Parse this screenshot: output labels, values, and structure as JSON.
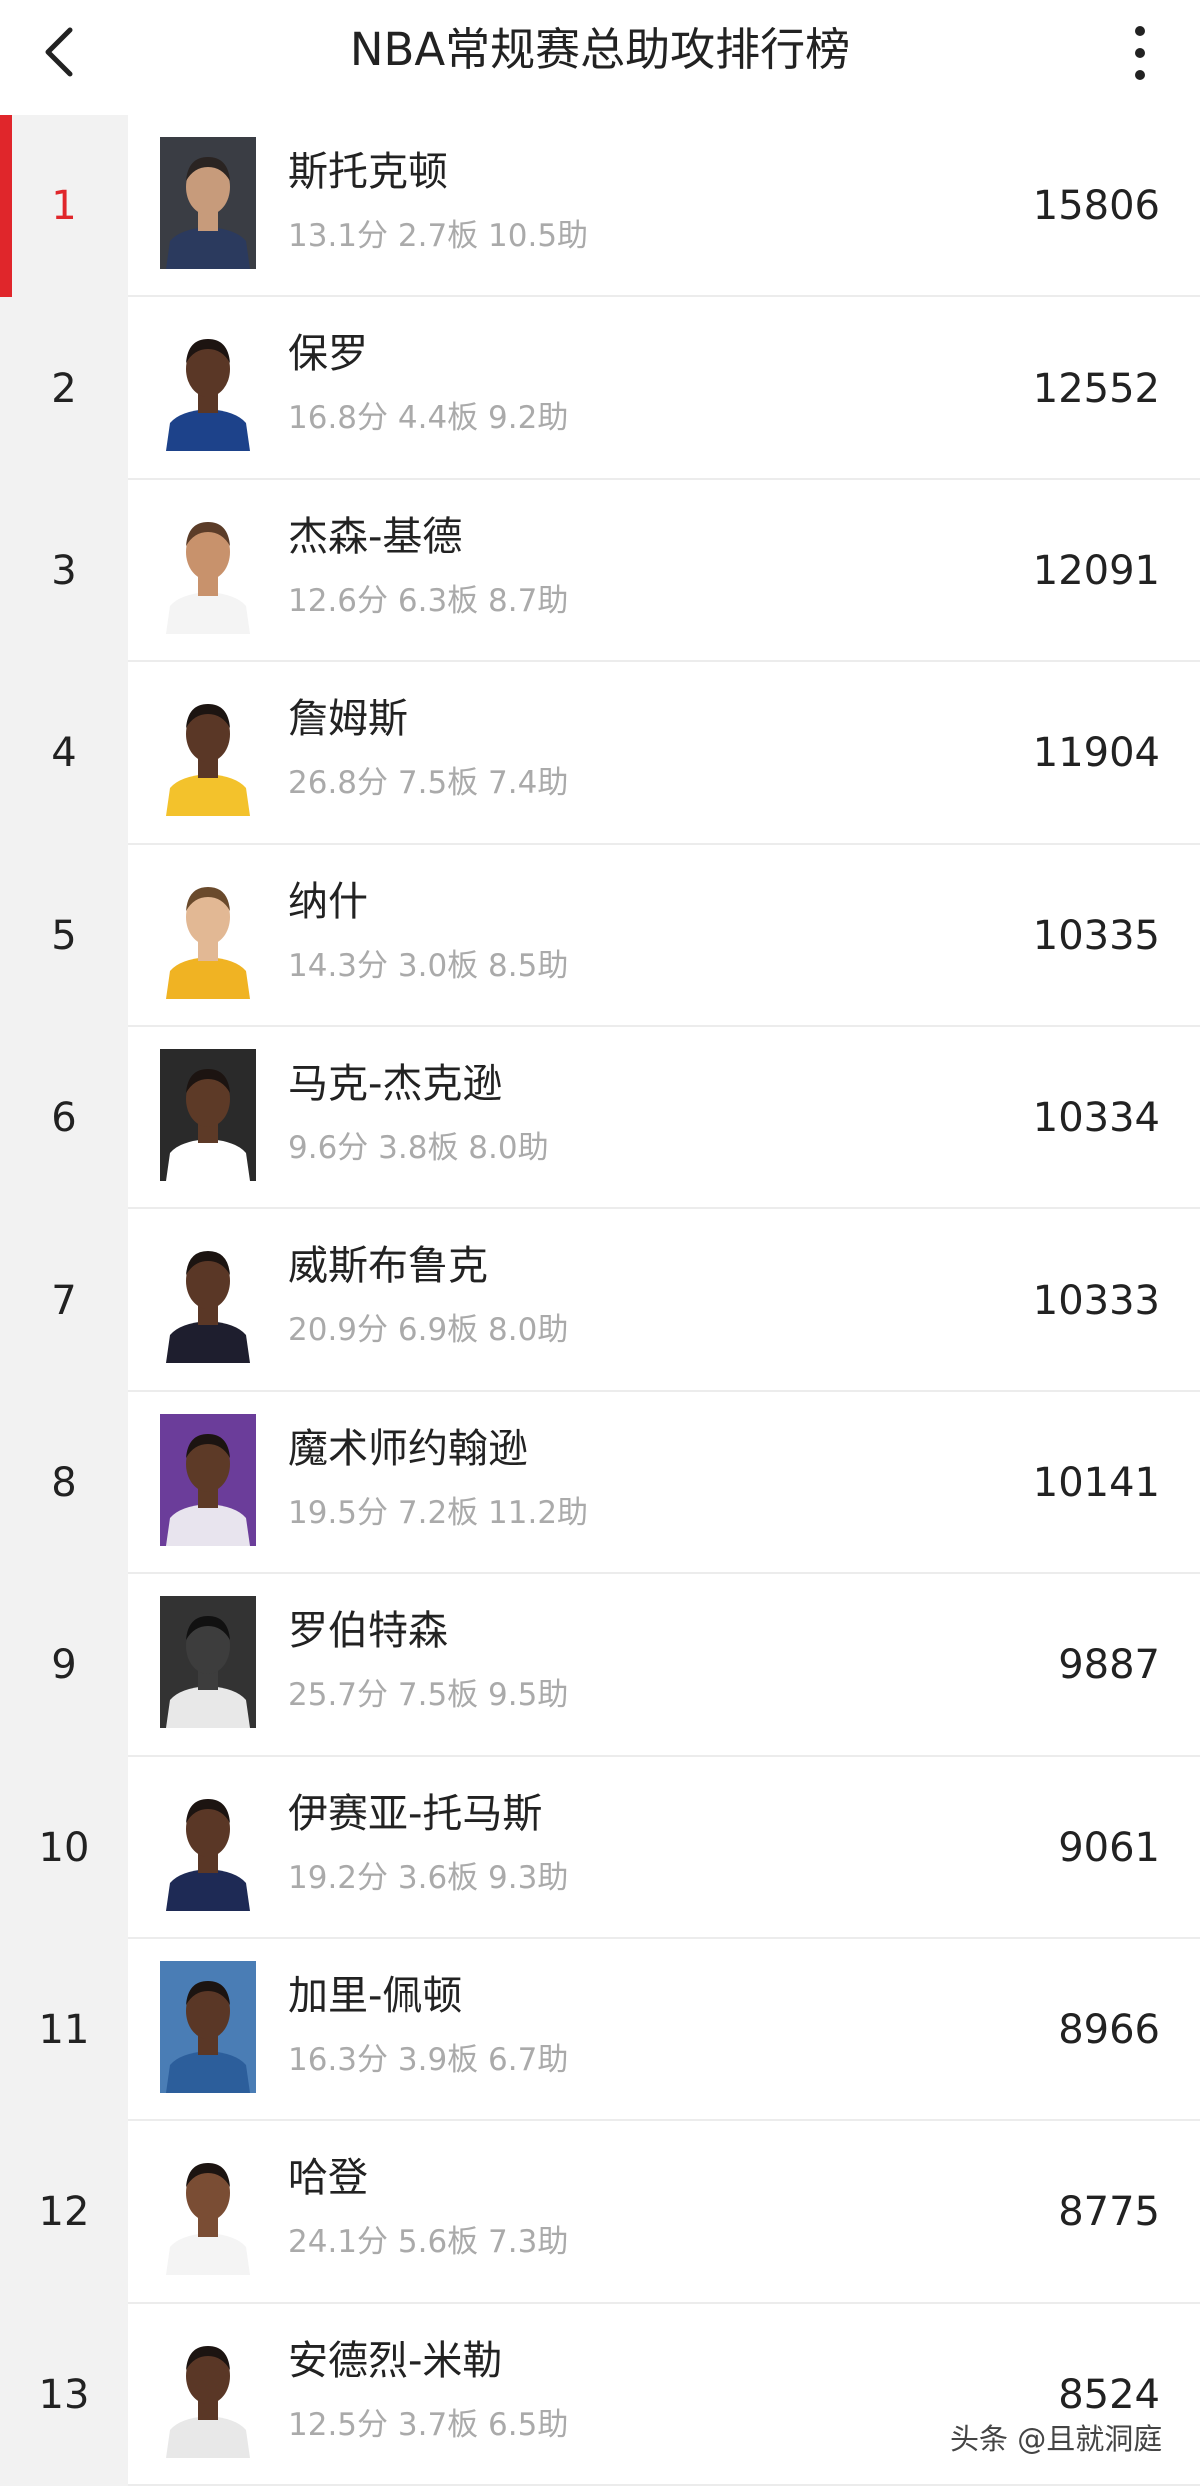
{
  "header": {
    "title": "NBA常规赛总助攻排行榜"
  },
  "players": [
    {
      "rank": "1",
      "name": "斯托克顿",
      "stats": "13.1分  2.7板  10.5助",
      "total": "15806",
      "avatar_bg": "#3a3d44",
      "jersey": "#2b3a5e",
      "skin": "#c79b7b",
      "hair": "#2a2422"
    },
    {
      "rank": "2",
      "name": "保罗",
      "stats": "16.8分  4.4板  9.2助",
      "total": "12552",
      "avatar_bg": "#ffffff",
      "jersey": "#1d428a",
      "skin": "#5a3726",
      "hair": "#1d1411"
    },
    {
      "rank": "3",
      "name": "杰森-基德",
      "stats": "12.6分  6.3板  8.7助",
      "total": "12091",
      "avatar_bg": "#ffffff",
      "jersey": "#f4f4f4",
      "skin": "#c8926c",
      "hair": "#5b3c28"
    },
    {
      "rank": "4",
      "name": "詹姆斯",
      "stats": "26.8分  7.5板  7.4助",
      "total": "11904",
      "avatar_bg": "#ffffff",
      "jersey": "#f3c22c",
      "skin": "#5a3726",
      "hair": "#1c1411"
    },
    {
      "rank": "5",
      "name": "纳什",
      "stats": "14.3分  3.0板  8.5助",
      "total": "10335",
      "avatar_bg": "#ffffff",
      "jersey": "#f0b323",
      "skin": "#e2b894",
      "hair": "#6a4a2c"
    },
    {
      "rank": "6",
      "name": "马克-杰克逊",
      "stats": "9.6分  3.8板  8.0助",
      "total": "10334",
      "avatar_bg": "#2a2a2a",
      "jersey": "#ffffff",
      "skin": "#5d3a27",
      "hair": "#1c1411"
    },
    {
      "rank": "7",
      "name": "威斯布鲁克",
      "stats": "20.9分  6.9板  8.0助",
      "total": "10333",
      "avatar_bg": "#ffffff",
      "jersey": "#1e1e2e",
      "skin": "#5a3726",
      "hair": "#1c1411"
    },
    {
      "rank": "8",
      "name": "魔术师约翰逊",
      "stats": "19.5分  7.2板  11.2助",
      "total": "10141",
      "avatar_bg": "#6b3d9a",
      "jersey": "#e8e4ee",
      "skin": "#5d3a27",
      "hair": "#1c1411"
    },
    {
      "rank": "9",
      "name": "罗伯特森",
      "stats": "25.7分  7.5板  9.5助",
      "total": "9887",
      "avatar_bg": "#333333",
      "jersey": "#e8e8e8",
      "skin": "#3d3d3d",
      "hair": "#111111"
    },
    {
      "rank": "10",
      "name": "伊赛亚-托马斯",
      "stats": "19.2分  3.6板  9.3助",
      "total": "9061",
      "avatar_bg": "#ffffff",
      "jersey": "#1e2a55",
      "skin": "#5a3726",
      "hair": "#1c1411"
    },
    {
      "rank": "11",
      "name": "加里-佩顿",
      "stats": "16.3分  3.9板  6.7助",
      "total": "8966",
      "avatar_bg": "#4a7db5",
      "jersey": "#2c5e9b",
      "skin": "#5a3726",
      "hair": "#1c1411"
    },
    {
      "rank": "12",
      "name": "哈登",
      "stats": "24.1分  5.6板  7.3助",
      "total": "8775",
      "avatar_bg": "#ffffff",
      "jersey": "#f4f4f4",
      "skin": "#7a4d34",
      "hair": "#1c1411"
    },
    {
      "rank": "13",
      "name": "安德烈-米勒",
      "stats": "12.5分  3.7板  6.5助",
      "total": "8524",
      "avatar_bg": "#ffffff",
      "jersey": "#e8e8e8",
      "skin": "#5a3726",
      "hair": "#1c1411"
    }
  ],
  "watermark": "头条 @且就洞庭",
  "colors": {
    "accent": "#e0262b",
    "rank_bg": "#f2f2f2",
    "stats_text": "#aaaaaa"
  }
}
